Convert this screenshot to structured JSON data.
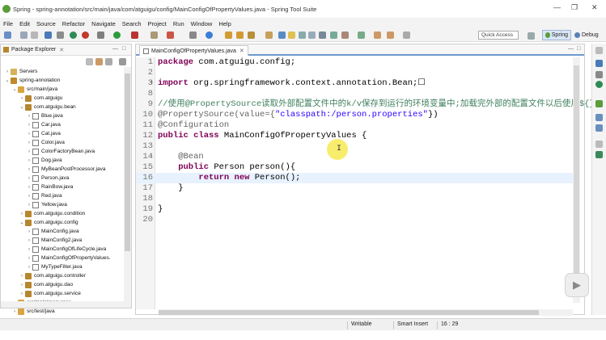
{
  "window": {
    "title": "Spring - spring-annotation/src/main/java/com/atguigu/config/MainConfigOfPropertyValues.java - Spring Tool Suite",
    "controls": [
      "—",
      "❐",
      "✕"
    ]
  },
  "menu": [
    "File",
    "Edit",
    "Source",
    "Refactor",
    "Navigate",
    "Search",
    "Project",
    "Run",
    "Window",
    "Help"
  ],
  "toolbar": {
    "quick_access": "Quick Access",
    "perspectives": [
      "Spring",
      "Debug"
    ]
  },
  "explorer": {
    "title": "Package Explorer",
    "tree": [
      {
        "label": "Servers",
        "depth": 0,
        "arrow": "›",
        "icon": "servers"
      },
      {
        "label": "spring-annotation",
        "depth": 0,
        "arrow": "⌄",
        "icon": "project"
      },
      {
        "label": "src/main/java",
        "depth": 1,
        "arrow": "⌄",
        "icon": "srcfolder"
      },
      {
        "label": "com.atguigu",
        "depth": 2,
        "arrow": "›",
        "icon": "package"
      },
      {
        "label": "com.atguigu.bean",
        "depth": 2,
        "arrow": "⌄",
        "icon": "package"
      },
      {
        "label": "Blue.java",
        "depth": 3,
        "arrow": "›",
        "icon": "java"
      },
      {
        "label": "Car.java",
        "depth": 3,
        "arrow": "›",
        "icon": "java"
      },
      {
        "label": "Cat.java",
        "depth": 3,
        "arrow": "›",
        "icon": "java"
      },
      {
        "label": "Color.java",
        "depth": 3,
        "arrow": "›",
        "icon": "java"
      },
      {
        "label": "ColorFactoryBean.java",
        "depth": 3,
        "arrow": "›",
        "icon": "java"
      },
      {
        "label": "Dog.java",
        "depth": 3,
        "arrow": "›",
        "icon": "java"
      },
      {
        "label": "MyBeanPostProcessor.java",
        "depth": 3,
        "arrow": "›",
        "icon": "java"
      },
      {
        "label": "Person.java",
        "depth": 3,
        "arrow": "›",
        "icon": "java"
      },
      {
        "label": "RainBow.java",
        "depth": 3,
        "arrow": "›",
        "icon": "java"
      },
      {
        "label": "Red.java",
        "depth": 3,
        "arrow": "›",
        "icon": "java"
      },
      {
        "label": "Yellow.java",
        "depth": 3,
        "arrow": "›",
        "icon": "java"
      },
      {
        "label": "com.atguigu.condition",
        "depth": 2,
        "arrow": "›",
        "icon": "package"
      },
      {
        "label": "com.atguigu.config",
        "depth": 2,
        "arrow": "⌄",
        "icon": "package"
      },
      {
        "label": "MainConfig.java",
        "depth": 3,
        "arrow": "›",
        "icon": "java"
      },
      {
        "label": "MainConfig2.java",
        "depth": 3,
        "arrow": "›",
        "icon": "java"
      },
      {
        "label": "MainConfigOfLifeCycle.java",
        "depth": 3,
        "arrow": "›",
        "icon": "java"
      },
      {
        "label": "MainConfigOfPropertyValues.",
        "depth": 3,
        "arrow": "›",
        "icon": "java"
      },
      {
        "label": "MyTypeFilter.java",
        "depth": 3,
        "arrow": "›",
        "icon": "java"
      },
      {
        "label": "com.atguigu.controller",
        "depth": 2,
        "arrow": "›",
        "icon": "package"
      },
      {
        "label": "com.atguigu.dao",
        "depth": 2,
        "arrow": "›",
        "icon": "package"
      },
      {
        "label": "com.atguigu.service",
        "depth": 2,
        "arrow": "›",
        "icon": "package"
      },
      {
        "label": "src/main/resources",
        "depth": 1,
        "arrow": "›",
        "icon": "srcfolder"
      },
      {
        "label": "src/test/java",
        "depth": 1,
        "arrow": "›",
        "icon": "srcfolder"
      }
    ]
  },
  "editor": {
    "tab_label": "MainConfigOfPropertyValues.java",
    "lines": [
      {
        "num": "1",
        "fold": "",
        "current": false,
        "tokens": [
          {
            "t": "package",
            "c": "kw"
          },
          {
            "t": " com.atguigu.config;",
            "c": "plain"
          }
        ]
      },
      {
        "num": "2",
        "fold": "",
        "current": false,
        "tokens": []
      },
      {
        "num": "3",
        "fold": "+",
        "current": false,
        "tokens": [
          {
            "t": "import",
            "c": "kw"
          },
          {
            "t": " org.springframework.context.annotation.Bean;",
            "c": "plain"
          },
          {
            "t": "☐",
            "c": "plain"
          }
        ]
      },
      {
        "num": "8",
        "fold": "",
        "current": false,
        "tokens": []
      },
      {
        "num": "9",
        "fold": "",
        "current": false,
        "tokens": [
          {
            "t": "//使用@PropertySource读取外部配置文件中的k/v保存到运行的环境变量中;加载完外部的配置文件以后使用${}取出配置",
            "c": "cmt"
          }
        ]
      },
      {
        "num": "10",
        "fold": "",
        "current": false,
        "tokens": [
          {
            "t": "@PropertySource(value={",
            "c": "ann"
          },
          {
            "t": "\"classpath:/person.properties\"",
            "c": "str"
          },
          {
            "t": "})",
            "c": "plain"
          }
        ]
      },
      {
        "num": "11",
        "fold": "",
        "current": false,
        "tokens": [
          {
            "t": "@Configuration",
            "c": "ann"
          }
        ]
      },
      {
        "num": "12",
        "fold": "",
        "current": false,
        "tokens": [
          {
            "t": "public class",
            "c": "kw"
          },
          {
            "t": " MainConfigOfPropertyValues {",
            "c": "plain"
          }
        ]
      },
      {
        "num": "13",
        "fold": "",
        "current": false,
        "tokens": []
      },
      {
        "num": "14",
        "fold": "-",
        "current": false,
        "tokens": [
          {
            "t": "    @Bean",
            "c": "ann"
          }
        ]
      },
      {
        "num": "15",
        "fold": "",
        "current": false,
        "tokens": [
          {
            "t": "    public",
            "c": "kw"
          },
          {
            "t": " Person person(){",
            "c": "plain"
          }
        ]
      },
      {
        "num": "16",
        "fold": "",
        "current": true,
        "tokens": [
          {
            "t": "        return new",
            "c": "kw"
          },
          {
            "t": " Person();",
            "c": "plain"
          }
        ]
      },
      {
        "num": "17",
        "fold": "",
        "current": false,
        "tokens": [
          {
            "t": "    }",
            "c": "plain"
          }
        ]
      },
      {
        "num": "18",
        "fold": "",
        "current": false,
        "tokens": []
      },
      {
        "num": "19",
        "fold": "",
        "current": false,
        "tokens": [
          {
            "t": "}",
            "c": "plain"
          }
        ]
      },
      {
        "num": "20",
        "fold": "",
        "current": false,
        "tokens": []
      }
    ]
  },
  "status": {
    "writable": "Writable",
    "insert_mode": "Smart Insert",
    "position": "16 : 29"
  },
  "colors": {
    "keyword": "#7f0055",
    "annotation": "#646464",
    "string": "#2a00ff",
    "comment": "#3f7f5f",
    "current_line": "#e8f2fe",
    "active_perspective": "#d9e6f5"
  }
}
